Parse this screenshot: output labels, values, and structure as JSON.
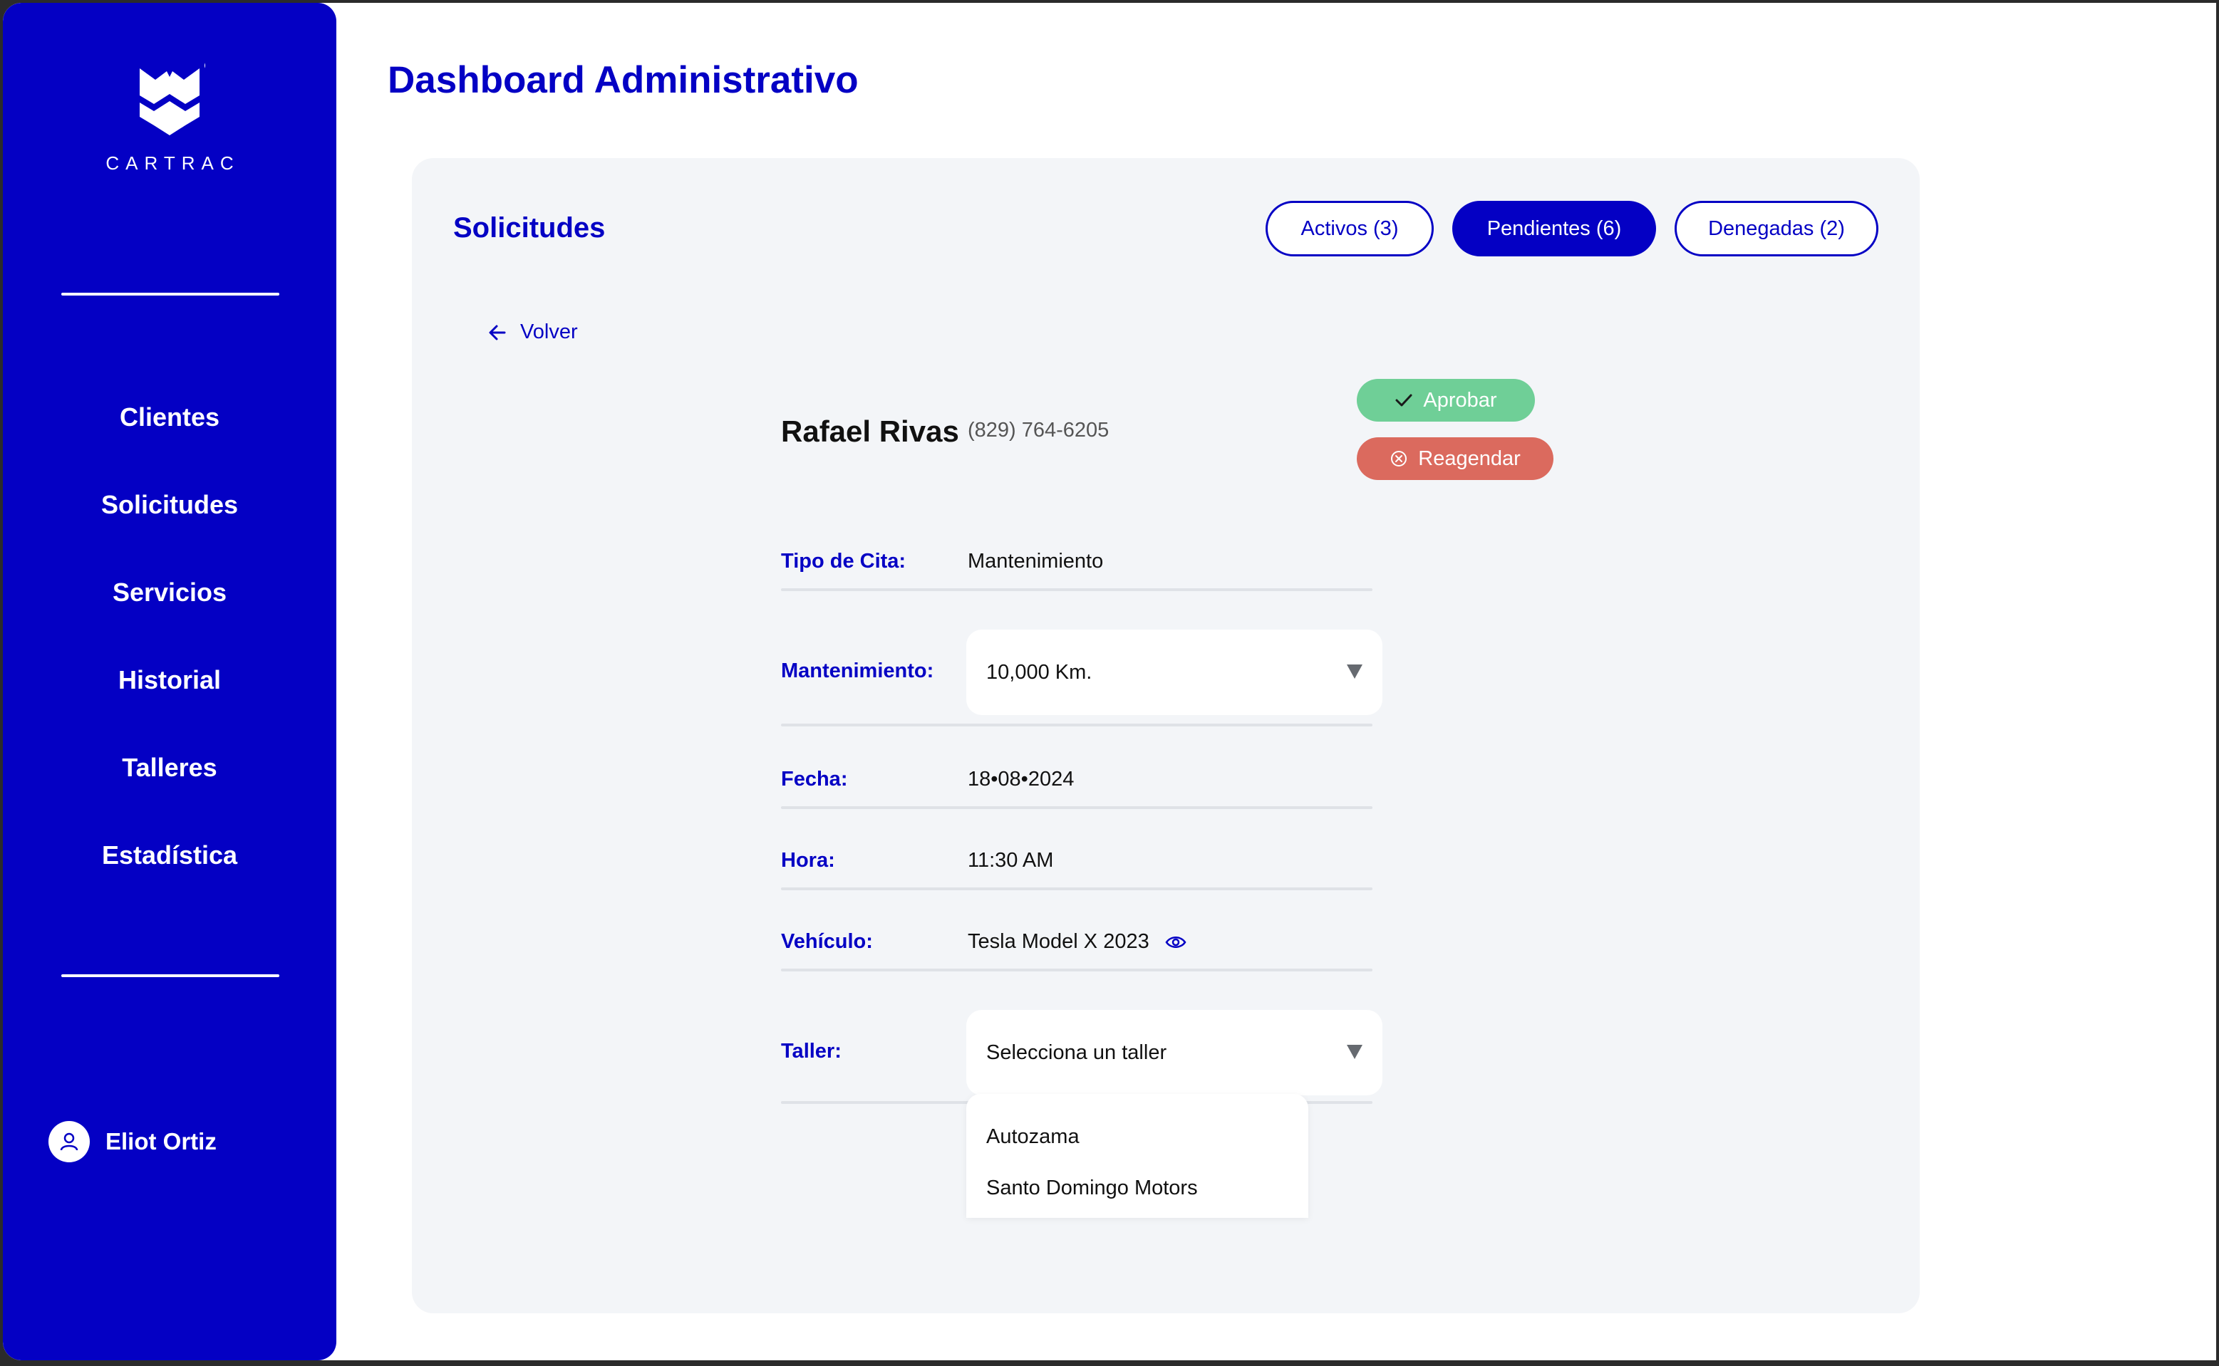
{
  "colors": {
    "brand": "#0400c4",
    "approve": "#6fcf97",
    "reschedule": "#db6a5e",
    "panel_bg": "#f3f5f8"
  },
  "sidebar": {
    "logo_text": "CARTRAC",
    "items": [
      {
        "label": "Clientes"
      },
      {
        "label": "Solicitudes"
      },
      {
        "label": "Servicios"
      },
      {
        "label": "Historial"
      },
      {
        "label": "Talleres"
      },
      {
        "label": "Estadística"
      }
    ],
    "user": {
      "name": "Eliot Ortiz",
      "icon": "user-icon"
    }
  },
  "header": {
    "title": "Dashboard Administrativo"
  },
  "panel": {
    "title": "Solicitudes",
    "tabs": [
      {
        "label": "Activos (3)",
        "active": false
      },
      {
        "label": "Pendientes (6)",
        "active": true
      },
      {
        "label": "Denegadas (2)",
        "active": false
      }
    ],
    "back_label": "Volver"
  },
  "request": {
    "client_name": "Rafael Rivas",
    "phone": "(829) 764-6205",
    "approve_label": "Aprobar",
    "reschedule_label": "Reagendar",
    "fields": {
      "tipo_label": "Tipo de Cita:",
      "tipo_value": "Mantenimiento",
      "mant_label": "Mantenimiento:",
      "mant_value": "10,000 Km.",
      "fecha_label": "Fecha:",
      "fecha_value": "18•08•2024",
      "hora_label": "Hora:",
      "hora_value": "11:30 AM",
      "vehiculo_label": "Vehículo:",
      "vehiculo_value": "Tesla Model X 2023",
      "taller_label": "Taller:",
      "taller_placeholder": "Selecciona un taller"
    },
    "taller_options": [
      "Autozama",
      "Santo Domingo Motors"
    ]
  }
}
